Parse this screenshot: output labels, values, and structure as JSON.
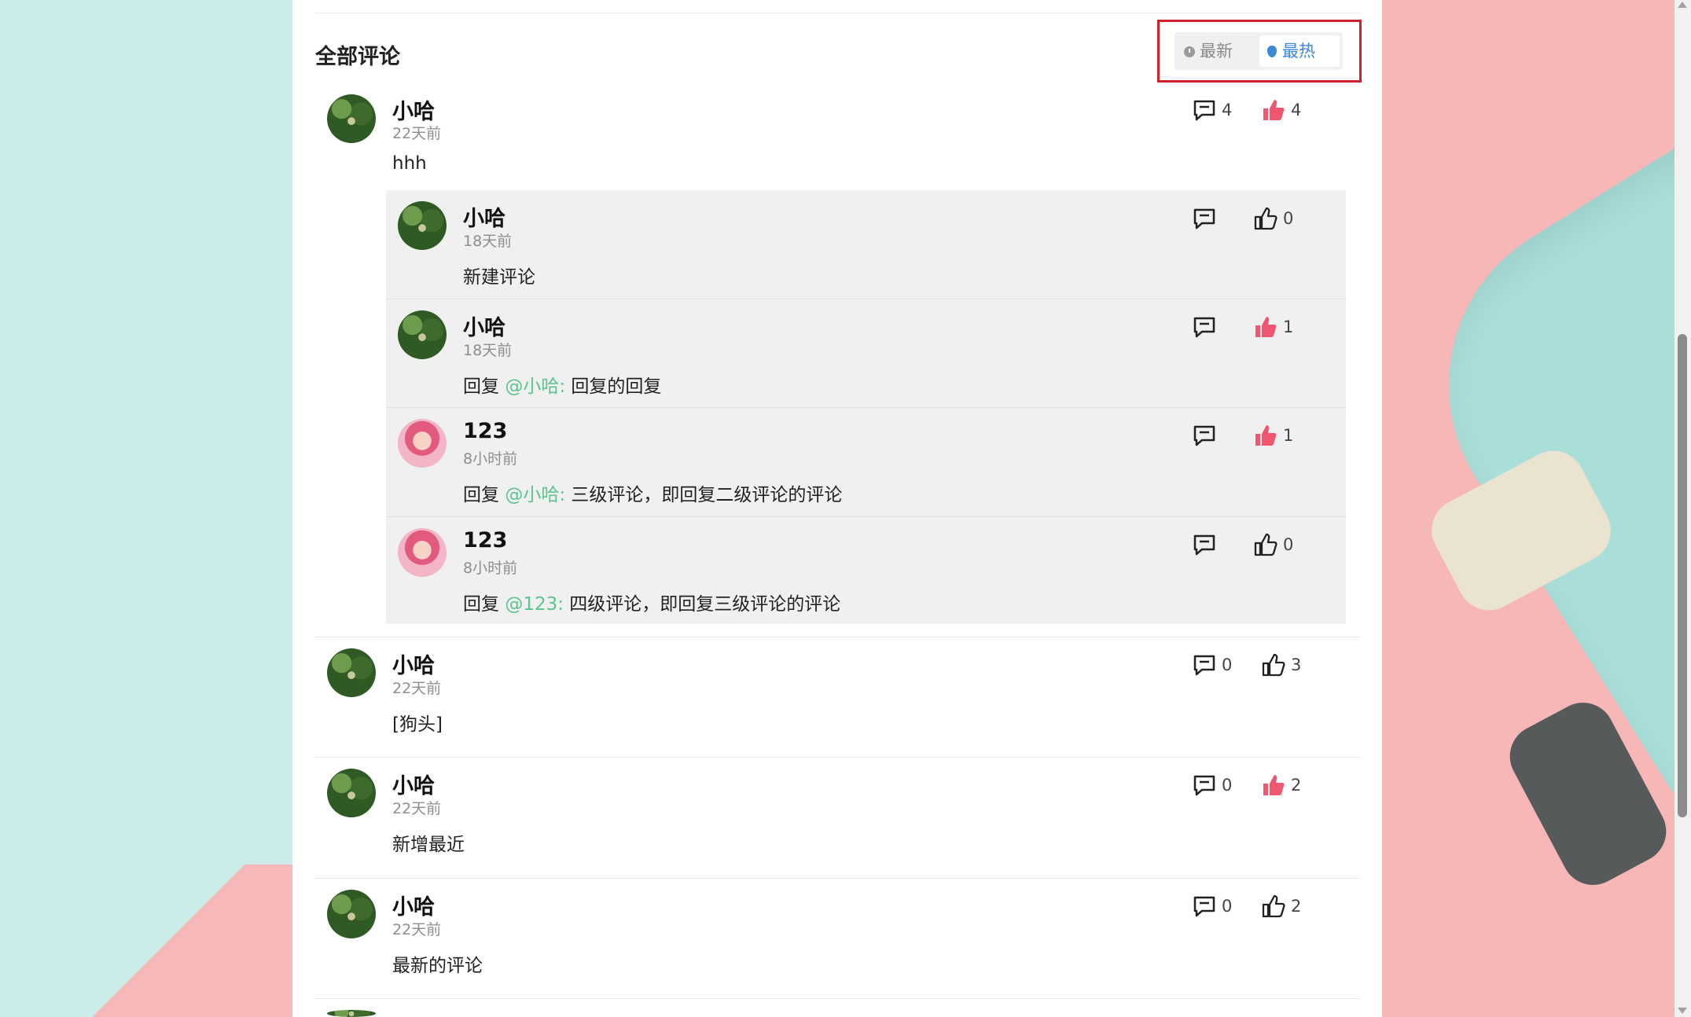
{
  "section_title": "全部评论",
  "sort": {
    "latest_label": "最新",
    "hot_label": "最热",
    "active": "最热"
  },
  "colors": {
    "accent": "#3b87d8",
    "mention": "#5cc38f",
    "liked": "#f0566f",
    "highlight_border": "#d0202b"
  },
  "comments": [
    {
      "user": "小哈",
      "time": "22天前",
      "text": "hhh",
      "reply_count": "4",
      "like_count": "4",
      "liked": true,
      "avatar": "deer-avatar",
      "replies": [
        {
          "user": "小哈",
          "time": "18天前",
          "text": "新建评论",
          "like_count": "0",
          "liked": false,
          "avatar": "deer-avatar"
        },
        {
          "user": "小哈",
          "time": "18天前",
          "prefix": "回复",
          "mention": "@小哈:",
          "text": "回复的回复",
          "like_count": "1",
          "liked": true,
          "avatar": "deer-avatar"
        },
        {
          "user": "123",
          "time": "8小时前",
          "prefix": "回复",
          "mention": "@小哈:",
          "text": "三级评论，即回复二级评论的评论",
          "like_count": "1",
          "liked": true,
          "avatar": "girl-avatar"
        },
        {
          "user": "123",
          "time": "8小时前",
          "prefix": "回复",
          "mention": "@123:",
          "text": "四级评论，即回复三级评论的评论",
          "like_count": "0",
          "liked": false,
          "avatar": "girl-avatar"
        }
      ]
    },
    {
      "user": "小哈",
      "time": "22天前",
      "text": "[狗头]",
      "reply_count": "0",
      "like_count": "3",
      "liked": false,
      "avatar": "deer-avatar"
    },
    {
      "user": "小哈",
      "time": "22天前",
      "text": "新增最近",
      "reply_count": "0",
      "like_count": "2",
      "liked": true,
      "avatar": "deer-avatar"
    },
    {
      "user": "小哈",
      "time": "22天前",
      "text": "最新的评论",
      "reply_count": "0",
      "like_count": "2",
      "liked": false,
      "avatar": "deer-avatar"
    }
  ]
}
